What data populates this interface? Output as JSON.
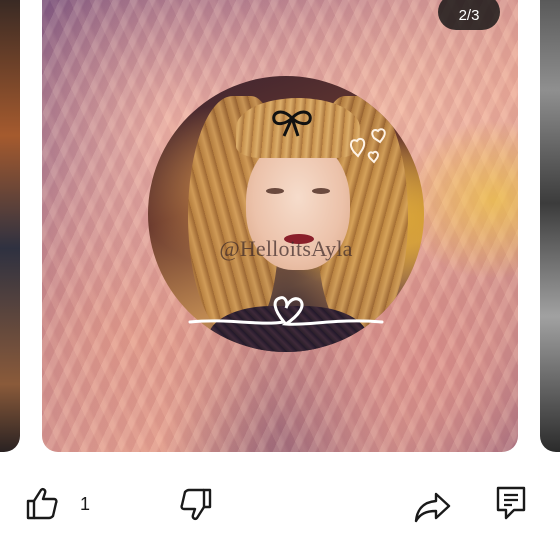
{
  "carousel": {
    "page_indicator": "2/3"
  },
  "post": {
    "watermark": "@HelloitsAyla",
    "image_subject": "portrait-in-circle"
  },
  "actions": {
    "like_count": "1",
    "icons": {
      "like": "thumbs-up-icon",
      "dislike": "thumbs-down-icon",
      "share": "share-arrow-icon",
      "comment": "comment-icon"
    }
  },
  "colors": {
    "background": "#ffffff",
    "icon": "#1a1a1a",
    "counter_bg": "#141414"
  }
}
